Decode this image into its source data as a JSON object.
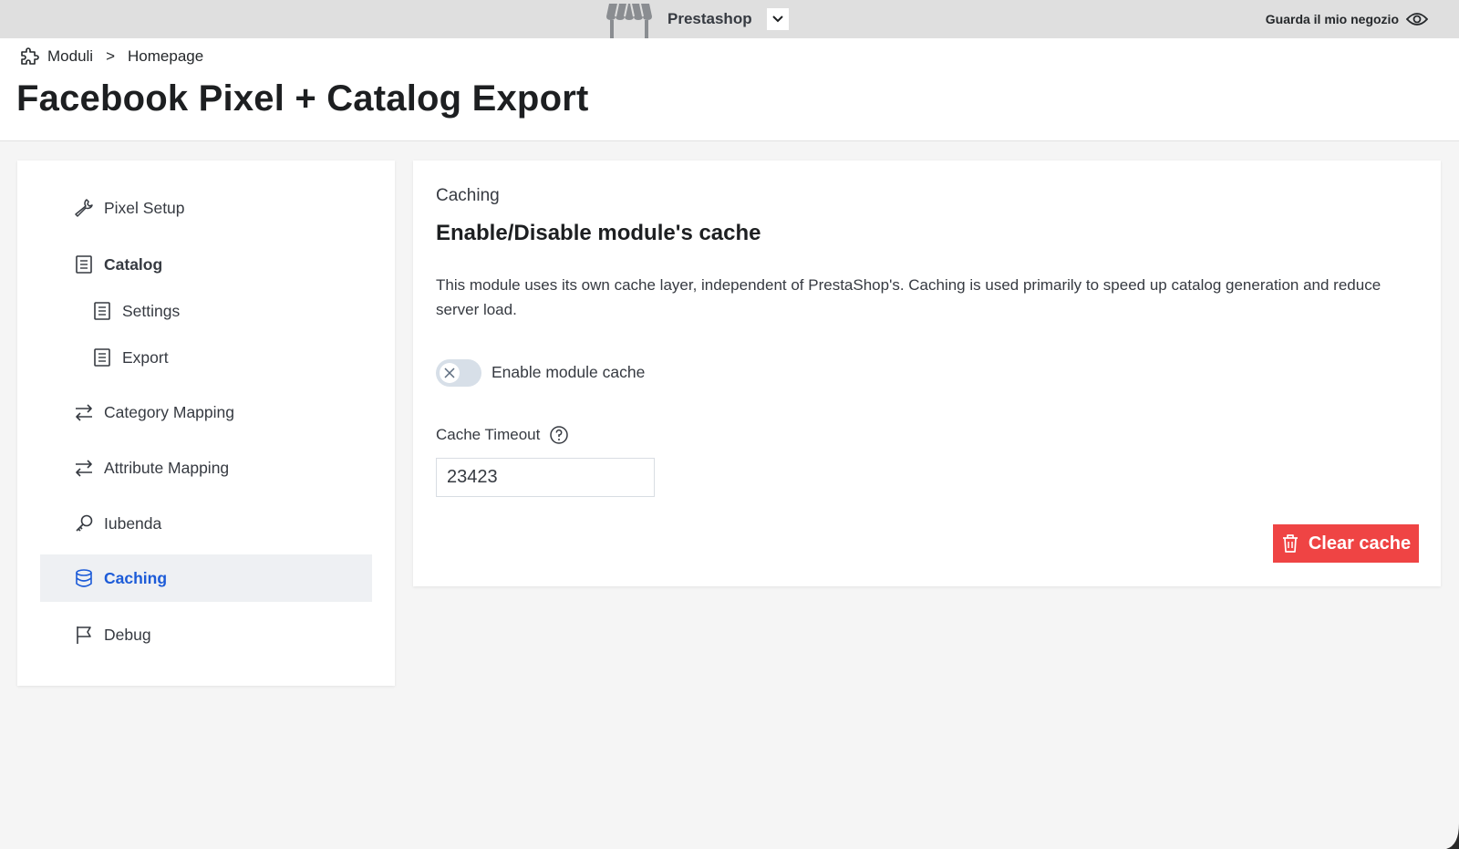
{
  "topbar": {
    "shop_name": "Prestashop",
    "view_shop": "Guarda il mio negozio"
  },
  "breadcrumb": {
    "parent": "Moduli",
    "separator": ">",
    "current": "Homepage"
  },
  "page_title": "Facebook Pixel + Catalog Export",
  "sidebar": {
    "items": [
      {
        "label": "Pixel Setup",
        "icon": "wrench-icon"
      },
      {
        "label": "Catalog",
        "icon": "document-icon"
      },
      {
        "label": "Settings",
        "icon": "document-icon"
      },
      {
        "label": "Export",
        "icon": "document-icon"
      },
      {
        "label": "Category Mapping",
        "icon": "arrows-exchange-icon"
      },
      {
        "label": "Attribute Mapping",
        "icon": "arrows-exchange-icon"
      },
      {
        "label": "Iubenda",
        "icon": "key-icon"
      },
      {
        "label": "Caching",
        "icon": "database-icon",
        "active": true
      },
      {
        "label": "Debug",
        "icon": "flag-icon"
      }
    ]
  },
  "main": {
    "section_label": "Caching",
    "section_title": "Enable/Disable module's cache",
    "description": "This module uses its own cache layer, independent of PrestaShop's. Caching is used primarily to speed up catalog generation and reduce server load.",
    "toggle_label": "Enable module cache",
    "toggle_enabled": false,
    "field_label": "Cache Timeout",
    "field_value": "23423",
    "clear_button": "Clear cache"
  },
  "colors": {
    "accent": "#1c5bd8",
    "danger": "#ef4444",
    "topbar": "#dfdfdf"
  }
}
